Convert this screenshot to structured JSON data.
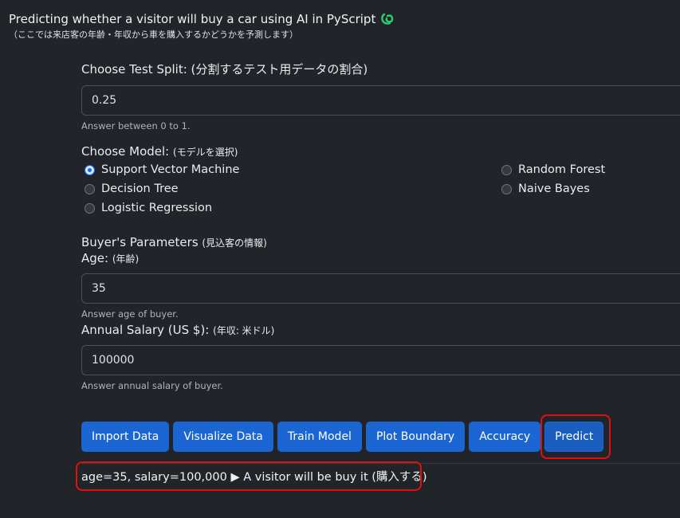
{
  "header": {
    "title": "Predicting whether a visitor will buy a car using AI in PyScript",
    "subtitle": "（ここでは来店客の年齢・年収から車を購入するかどうかを予測します）"
  },
  "test_split": {
    "label": "Choose Test Split: (分割するテスト用データの割合)",
    "value": "0.25",
    "help": "Answer between 0 to 1."
  },
  "model": {
    "label": "Choose Model: ",
    "label_jp": "(モデルを選択)",
    "options": [
      {
        "label": "Support Vector Machine",
        "checked": true
      },
      {
        "label": "Decision Tree",
        "checked": false
      },
      {
        "label": "Logistic Regression",
        "checked": false
      },
      {
        "label": "Random Forest",
        "checked": false
      },
      {
        "label": "Naive Bayes",
        "checked": false
      }
    ]
  },
  "buyer": {
    "section_label": "Buyer's Parameters ",
    "section_label_jp": "(見込客の情報)",
    "age": {
      "label": "Age: ",
      "label_jp": "(年齢)",
      "value": "35",
      "help": "Answer age of buyer."
    },
    "salary": {
      "label": "Annual Salary (US $): ",
      "label_jp": "(年収: 米ドル)",
      "value": "100000",
      "help": "Answer annual salary of buyer."
    }
  },
  "buttons": {
    "import": "Import Data",
    "visualize": "Visualize Data",
    "train": "Train Model",
    "plot": "Plot Boundary",
    "accuracy": "Accuracy",
    "predict": "Predict"
  },
  "result": {
    "text": "age=35, salary=100,000 ▶ A visitor will be buy it (購入する)"
  },
  "colors": {
    "background": "#212529",
    "button": "#1b66d2",
    "highlight": "#e01010",
    "logo": "#2ecc71"
  }
}
